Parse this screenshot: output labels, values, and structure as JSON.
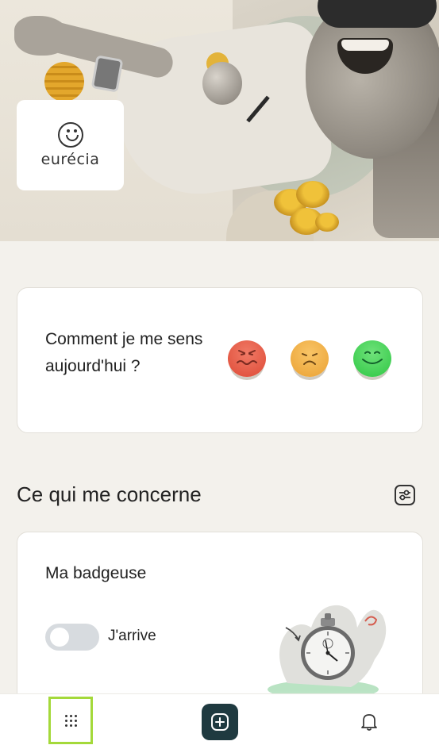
{
  "brand": {
    "logo_text": "eurécia",
    "logo_icon": "eurecia-smile-logo"
  },
  "mood": {
    "question": "Comment je me sens aujourd'hui ?",
    "options": [
      {
        "name": "bad",
        "icon": "angry-face-icon",
        "color": "#e4543f"
      },
      {
        "name": "neutral",
        "icon": "sad-face-icon",
        "color": "#f0b144"
      },
      {
        "name": "good",
        "icon": "happy-face-icon",
        "color": "#3ed452"
      }
    ]
  },
  "section": {
    "title": "Ce qui me concerne",
    "filter_icon": "sliders-icon"
  },
  "badge_card": {
    "title": "Ma badgeuse",
    "toggle_label": "J'arrive",
    "toggle_on": false,
    "illustration": "stopwatch-illustration"
  },
  "bottom_nav": {
    "items": [
      {
        "name": "apps",
        "icon": "grid-icon",
        "selected": true
      },
      {
        "name": "add",
        "icon": "plus-square-icon",
        "selected": false
      },
      {
        "name": "notifications",
        "icon": "bell-icon",
        "selected": false
      }
    ],
    "accent": "#a4d93a",
    "add_color": "#1f3a40"
  }
}
